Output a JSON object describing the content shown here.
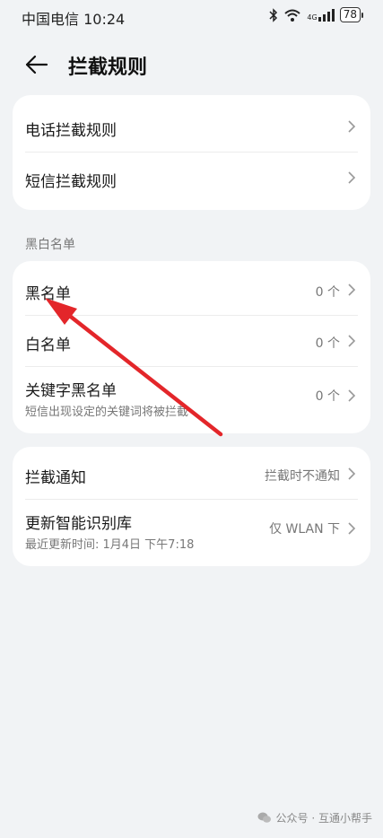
{
  "status": {
    "carrier_time": "中国电信 10:24",
    "net_label": "4G",
    "battery": "78"
  },
  "header": {
    "title": "拦截规则"
  },
  "rules": [
    {
      "label": "电话拦截规则"
    },
    {
      "label": "短信拦截规则"
    }
  ],
  "section": {
    "blackwhite": "黑白名单"
  },
  "lists": [
    {
      "label": "黑名单",
      "value": "0 个"
    },
    {
      "label": "白名单",
      "value": "0 个"
    },
    {
      "label": "关键字黑名单",
      "sub": "短信出现设定的关键词将被拦截",
      "value": "0 个"
    }
  ],
  "settings": [
    {
      "label": "拦截通知",
      "value": "拦截时不通知"
    },
    {
      "label": "更新智能识别库",
      "sub": "最近更新时间: 1月4日 下午7:18",
      "value": "仅 WLAN 下"
    }
  ],
  "watermark": "公众号 · 互通小帮手",
  "colors": {
    "annotation_arrow": "#e3262a",
    "background": "#f1f3f5",
    "card": "#ffffff"
  }
}
